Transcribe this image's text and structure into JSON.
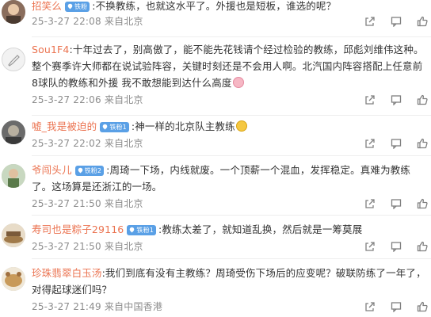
{
  "badge_label": "铁粉",
  "comments": [
    {
      "username": "招笑么",
      "badge_level": "",
      "content": ":不换教练，也就这水平了。外援也是短板，谁选的呢？",
      "time": "25-3-27 22:08",
      "location": "来自北京",
      "avatar_color": "#7a5a4a"
    },
    {
      "username": "Sou1F4",
      "badge_level": "",
      "content": ":十年过去了，别高傲了，能不能先花钱请个经过检验的教练，邱彪刘维伟这种。整个赛季许大师都在说试验阵容，关键时刻还是不会用人啊。北汽国内阵容搭配上任意前8球队的教练和外援 我不敢想能到达什么高度",
      "time": "25-3-27 22:06",
      "location": "来自北京",
      "avatar_color": "#dcdcdc"
    },
    {
      "username": "嘘_我是被迫的",
      "badge_level": "1",
      "content": ":神一样的北京队主教练",
      "time": "25-3-27 22:02",
      "location": "来自北京",
      "avatar_color": "#5a5a5a"
    },
    {
      "username": "爷闯头儿",
      "badge_level": "2",
      "content": ":周琦一下场，内线就废。一个顶薪一个混血，发挥稳定。真难为教练了。这场算是还浙江的一场。",
      "time": "25-3-27 21:50",
      "location": "来自北京",
      "avatar_color": "#6e8a5a"
    },
    {
      "username": "寿司也是粽子29116",
      "badge_level": "1",
      "content": ":教练太差了，就知道乱换，然后就是一筹莫展",
      "time": "25-3-27 21:50",
      "location": "来自北京",
      "avatar_color": "#9a7a54"
    },
    {
      "username": "珍珠翡翠白玉汤",
      "badge_level": "",
      "content": ":我们到底有没有主教练？周琦受伤下场后的应变呢？破联防练了一年了，对得起球迷们吗？",
      "time": "25-3-27 21:49",
      "location": "来自中国香港",
      "avatar_color": "#c9a36a"
    }
  ],
  "actions": [
    "share-icon",
    "comment-icon",
    "like-icon"
  ]
}
